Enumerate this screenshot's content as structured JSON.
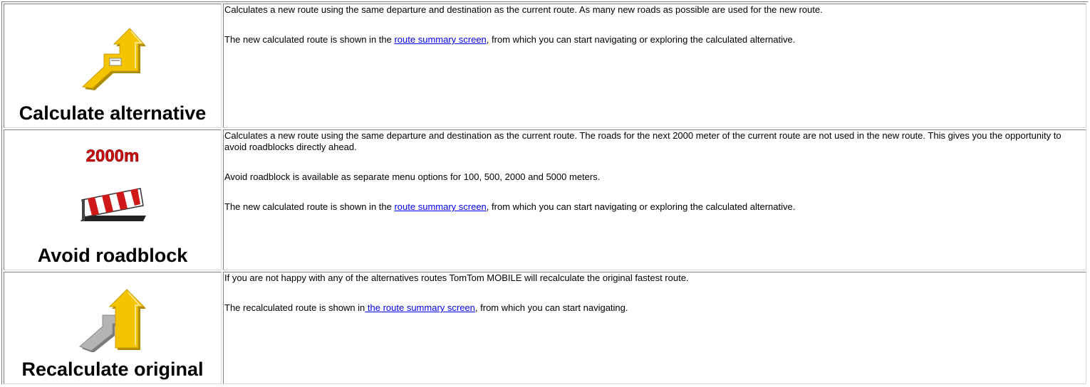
{
  "rows": [
    {
      "label": "Calculate alternative",
      "icon": "calculate-alternative-icon",
      "paragraphs": [
        {
          "text": "Calculates a new route using the same departure and destination as the current route. As many new roads as possible are used for the new route."
        },
        {
          "before": "The new calculated route is shown in the ",
          "link": "route summary screen",
          "after": ", from which you can start navigating or exploring the calculated alternative."
        }
      ]
    },
    {
      "label": "Avoid roadblock",
      "icon": "roadblock-icon",
      "icon_text": "2000m",
      "paragraphs": [
        {
          "text": "Calculates a new route using the same departure and destination as the current route. The roads for the next 2000 meter of the current route are not used in the new route. This gives you the opportunity to avoid roadblocks directly ahead."
        },
        {
          "text": "Avoid roadblock is available as separate menu options for 100, 500, 2000 and 5000 meters."
        },
        {
          "before": "The new calculated route is shown in the ",
          "link": "route summary screen",
          "after": ", from which you can start navigating or exploring the calculated alternative."
        }
      ]
    },
    {
      "label": "Recalculate original",
      "icon": "recalculate-original-icon",
      "paragraphs": [
        {
          "text": "If you are not happy with any of the alternatives routes TomTom MOBILE will recalculate the original fastest route."
        },
        {
          "before": "The recalculated route is shown in",
          "link": " the route summary screen",
          "after": ", from which you can start navigating."
        }
      ]
    }
  ],
  "colors": {
    "arrow_yellow": "#f5c400",
    "arrow_shadow": "#b08a00",
    "road_grey": "#a8a8a8",
    "barrier_red": "#d01818",
    "link": "#0000ee",
    "icon_text_red": "#cc1010"
  }
}
